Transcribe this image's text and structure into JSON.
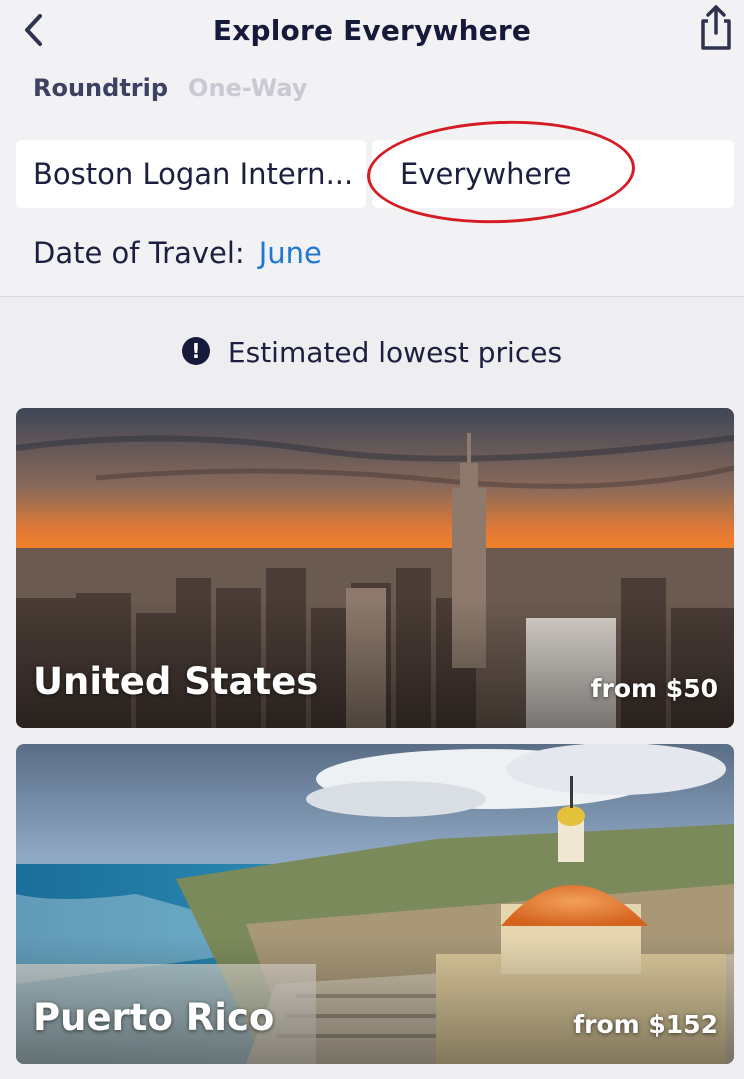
{
  "header": {
    "title": "Explore Everywhere"
  },
  "trip_types": {
    "roundtrip": "Roundtrip",
    "one_way": "One-Way"
  },
  "search": {
    "origin": "Boston Logan Intern...",
    "destination": "Everywhere"
  },
  "date": {
    "label": "Date of Travel:",
    "value": "June"
  },
  "notice": {
    "text": "Estimated lowest prices"
  },
  "destinations": [
    {
      "name": "United States",
      "price": "from $50"
    },
    {
      "name": "Puerto Rico",
      "price": "from $152"
    }
  ],
  "colors": {
    "accent": "#1e78d4",
    "annotation": "#d51c25",
    "text": "#161a3a"
  }
}
